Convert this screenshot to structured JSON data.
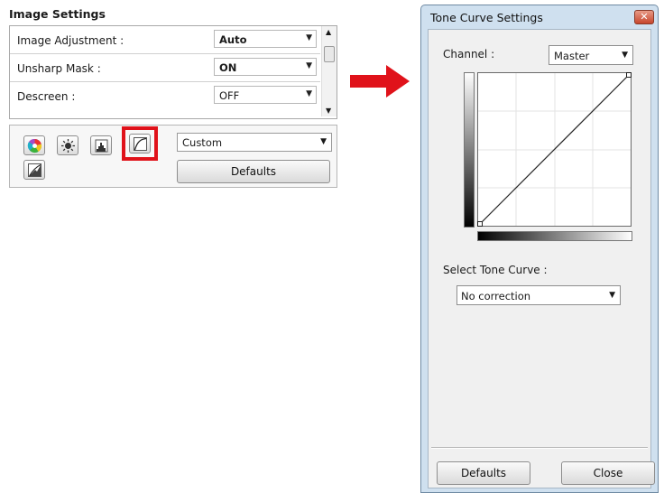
{
  "image_settings": {
    "title": "Image Settings",
    "rows": [
      {
        "label": "Image Adjustment :",
        "value": "Auto"
      },
      {
        "label": "Unsharp Mask :",
        "value": "ON"
      },
      {
        "label": "Descreen :",
        "value": "OFF"
      }
    ],
    "toolbar": {
      "buttons": [
        "color-balance-icon",
        "brightness-icon",
        "histogram-icon",
        "tone-curve-icon",
        "final-review-icon"
      ],
      "highlighted": "tone-curve-icon",
      "preset_value": "Custom",
      "defaults_label": "Defaults"
    }
  },
  "tone_curve_dialog": {
    "title": "Tone Curve Settings",
    "channel_label": "Channel :",
    "channel_value": "Master",
    "select_curve_label": "Select Tone Curve :",
    "select_curve_value": "No correction",
    "defaults_label": "Defaults",
    "close_label": "Close"
  },
  "colors": {
    "highlight": "#e0121a",
    "arrow": "#e0121a",
    "dialog_frame": "#cfe0ef",
    "close_button": "#c7462c"
  }
}
